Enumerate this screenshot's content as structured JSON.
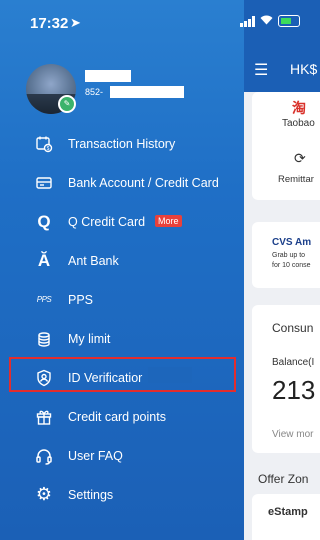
{
  "status": {
    "time": "17:32"
  },
  "profile": {
    "phone_prefix": "852-"
  },
  "menu": [
    {
      "label": "Transaction History",
      "icon": "transaction-history-icon"
    },
    {
      "label": "Bank Account / Credit Card",
      "icon": "bank-card-icon"
    },
    {
      "label": "Q Credit Card",
      "icon": "q-credit-card-icon",
      "badge": "More"
    },
    {
      "label": "Ant Bank",
      "icon": "ant-bank-icon"
    },
    {
      "label": "PPS",
      "icon": "pps-icon"
    },
    {
      "label": "My limit",
      "icon": "limit-icon"
    },
    {
      "label": "ID Verificatior",
      "icon": "id-verification-icon"
    },
    {
      "label": "Credit card points",
      "icon": "gift-icon"
    },
    {
      "label": "User FAQ",
      "icon": "headset-icon"
    },
    {
      "label": "Settings",
      "icon": "settings-icon"
    }
  ],
  "background_app": {
    "header_label": "HK$",
    "taobao": "Taobao",
    "remittance": "Remittar",
    "cvs_title": "CVS Am",
    "cvs_line1": "Grab up to",
    "cvs_line2": "for 10 conse",
    "consumption": "Consun",
    "balance": "Balance(I",
    "amount": "213",
    "view_more": "View mor",
    "offer": "Offer Zon",
    "estamp": "eStamp"
  },
  "colors": {
    "drawer": "#1f6fc6",
    "highlight_border": "#e32d2d",
    "badge": "#e8413b"
  }
}
